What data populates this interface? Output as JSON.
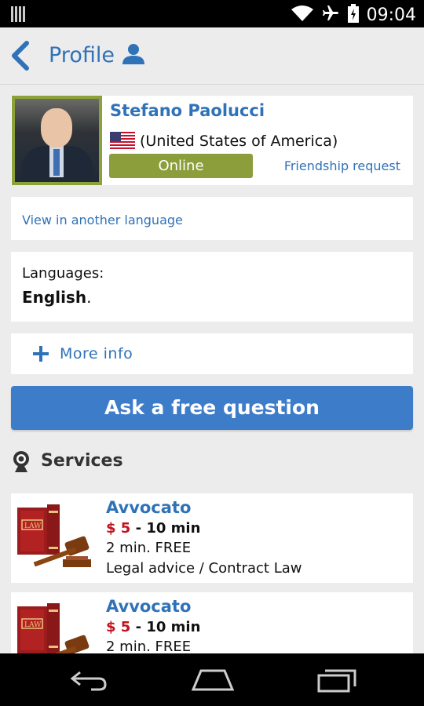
{
  "status_bar": {
    "time": "09:04"
  },
  "action_bar": {
    "title": "Profile"
  },
  "profile": {
    "name": "Stefano Paolucci",
    "country": "(United States of America)",
    "status": "Online",
    "friendship_link": "Friendship request"
  },
  "language_link": "View in another language",
  "languages": {
    "label": "Languages:",
    "value": "English",
    "suffix": "."
  },
  "more_info": {
    "label": "More info"
  },
  "ask_button": {
    "label": "Ask a free question"
  },
  "services": {
    "title": "Services",
    "items": [
      {
        "title": "Avvocato",
        "price": "$ 5",
        "duration": "- 10 min",
        "free": "2 min. FREE",
        "description": "Legal advice / Contract Law"
      },
      {
        "title": "Avvocato",
        "price": "$ 5",
        "duration": "- 10 min",
        "free": "2 min. FREE"
      }
    ]
  },
  "colors": {
    "accent": "#2f72b8",
    "online": "#8c9d3b",
    "price": "#c1121f",
    "button": "#3d7cc9"
  }
}
